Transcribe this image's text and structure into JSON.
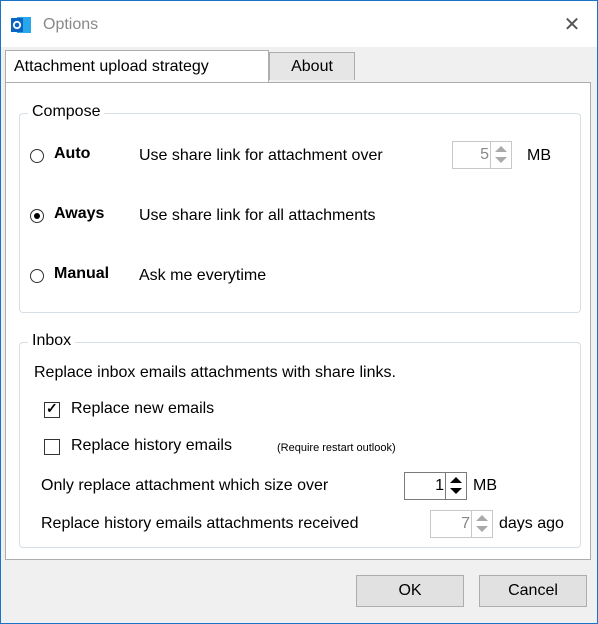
{
  "window": {
    "title": "Options",
    "close_glyph": "✕",
    "app_icon": "outlook-icon"
  },
  "tabs": [
    {
      "label": "Attachment upload strategy",
      "active": true
    },
    {
      "label": "About",
      "active": false
    }
  ],
  "compose": {
    "legend": "Compose",
    "options": [
      {
        "name": "Auto",
        "description": "Use share link for attachment over",
        "selected": false
      },
      {
        "name": "Aways",
        "description": "Use share link for all attachments",
        "selected": true
      },
      {
        "name": "Manual",
        "description": "Ask me everytime",
        "selected": false
      }
    ],
    "auto_size_value": "5",
    "auto_size_unit": "MB"
  },
  "inbox": {
    "legend": "Inbox",
    "intro": "Replace inbox emails attachments with share links.",
    "replace_new": {
      "label": "Replace new emails",
      "checked": true
    },
    "replace_history": {
      "label": "Replace history emails",
      "checked": false,
      "note": "(Require restart outlook)"
    },
    "size_label": "Only replace attachment which size over",
    "size_value": "1",
    "size_unit": "MB",
    "history_label": "Replace history emails attachments received",
    "history_value": "7",
    "history_unit": "days ago"
  },
  "buttons": {
    "ok": "OK",
    "cancel": "Cancel"
  },
  "colors": {
    "border_accent": "#1a73c9",
    "outlook_blue": "#0a64c2"
  }
}
